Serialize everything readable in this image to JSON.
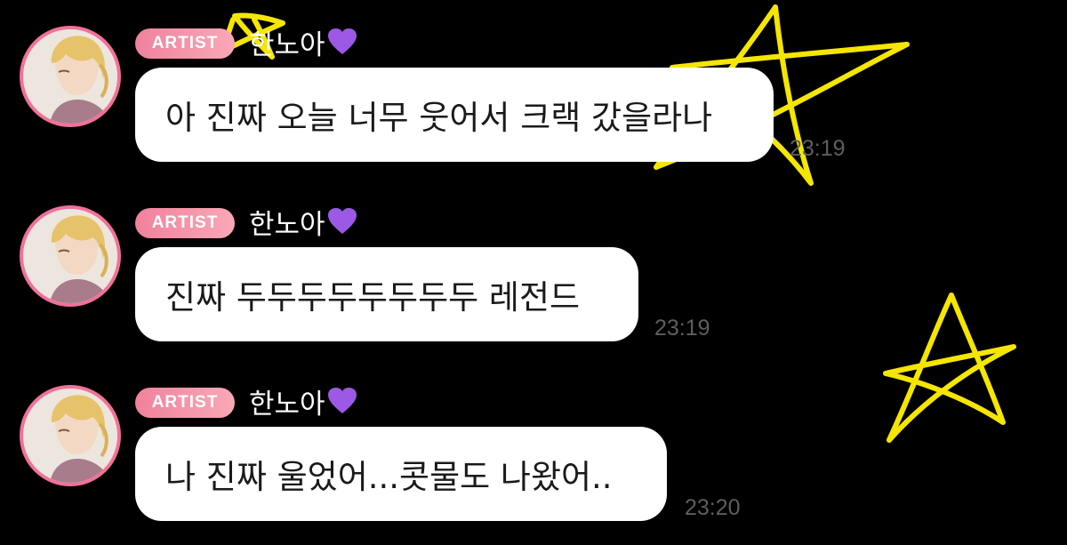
{
  "colors": {
    "background": "#000000",
    "bubble": "#ffffff",
    "badge": "#f0819c",
    "avatar_ring": "#f2709a",
    "doodle": "#f5e600",
    "timestamp": "#5e5e5e"
  },
  "messages": [
    {
      "badge": "ARTIST",
      "sender": "한노아",
      "sender_icon": "purple-heart-icon",
      "text": "아 진짜 오늘 너무 웃어서 크랙 갔을라나",
      "time": "23:19"
    },
    {
      "badge": "ARTIST",
      "sender": "한노아",
      "sender_icon": "purple-heart-icon",
      "text": "진짜 두두두두두두두두 레전드",
      "time": "23:19"
    },
    {
      "badge": "ARTIST",
      "sender": "한노아",
      "sender_icon": "purple-heart-icon",
      "text": "나 진짜 울었어...콧물도 나왔어..",
      "time": "23:20"
    }
  ]
}
